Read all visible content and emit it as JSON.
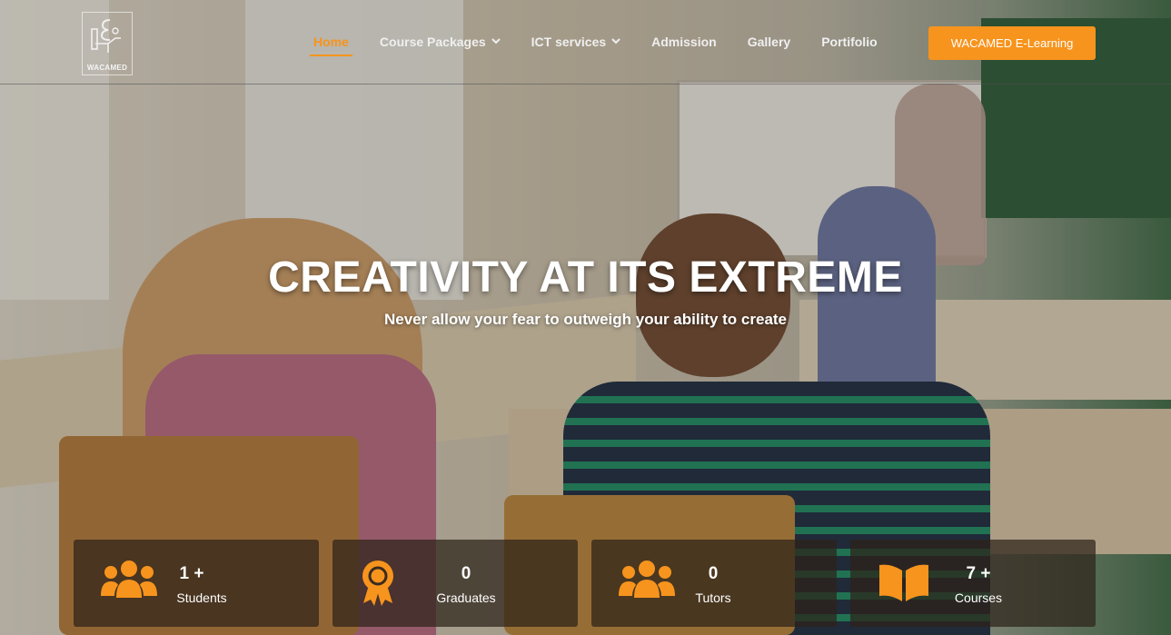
{
  "brand": {
    "logo_text": "WACAMED",
    "accent_color": "#f7941d"
  },
  "nav": {
    "items": [
      {
        "label": "Home",
        "active": true,
        "has_dropdown": false
      },
      {
        "label": "Course Packages",
        "active": false,
        "has_dropdown": true
      },
      {
        "label": "ICT services",
        "active": false,
        "has_dropdown": true
      },
      {
        "label": "Admission",
        "active": false,
        "has_dropdown": false
      },
      {
        "label": "Gallery",
        "active": false,
        "has_dropdown": false
      },
      {
        "label": "Portifolio",
        "active": false,
        "has_dropdown": false
      }
    ],
    "cta_label": "WACAMED E-Learning"
  },
  "hero": {
    "headline": "CREATIVITY AT ITS EXTREME",
    "subheadline": "Never allow your fear to outweigh your ability to create"
  },
  "stats": [
    {
      "value": "1 +",
      "label": "Students",
      "icon": "users-icon"
    },
    {
      "value": "0",
      "label": "Graduates",
      "icon": "award-icon"
    },
    {
      "value": "0",
      "label": "Tutors",
      "icon": "users-icon"
    },
    {
      "value": "7 +",
      "label": "Courses",
      "icon": "book-icon"
    }
  ]
}
